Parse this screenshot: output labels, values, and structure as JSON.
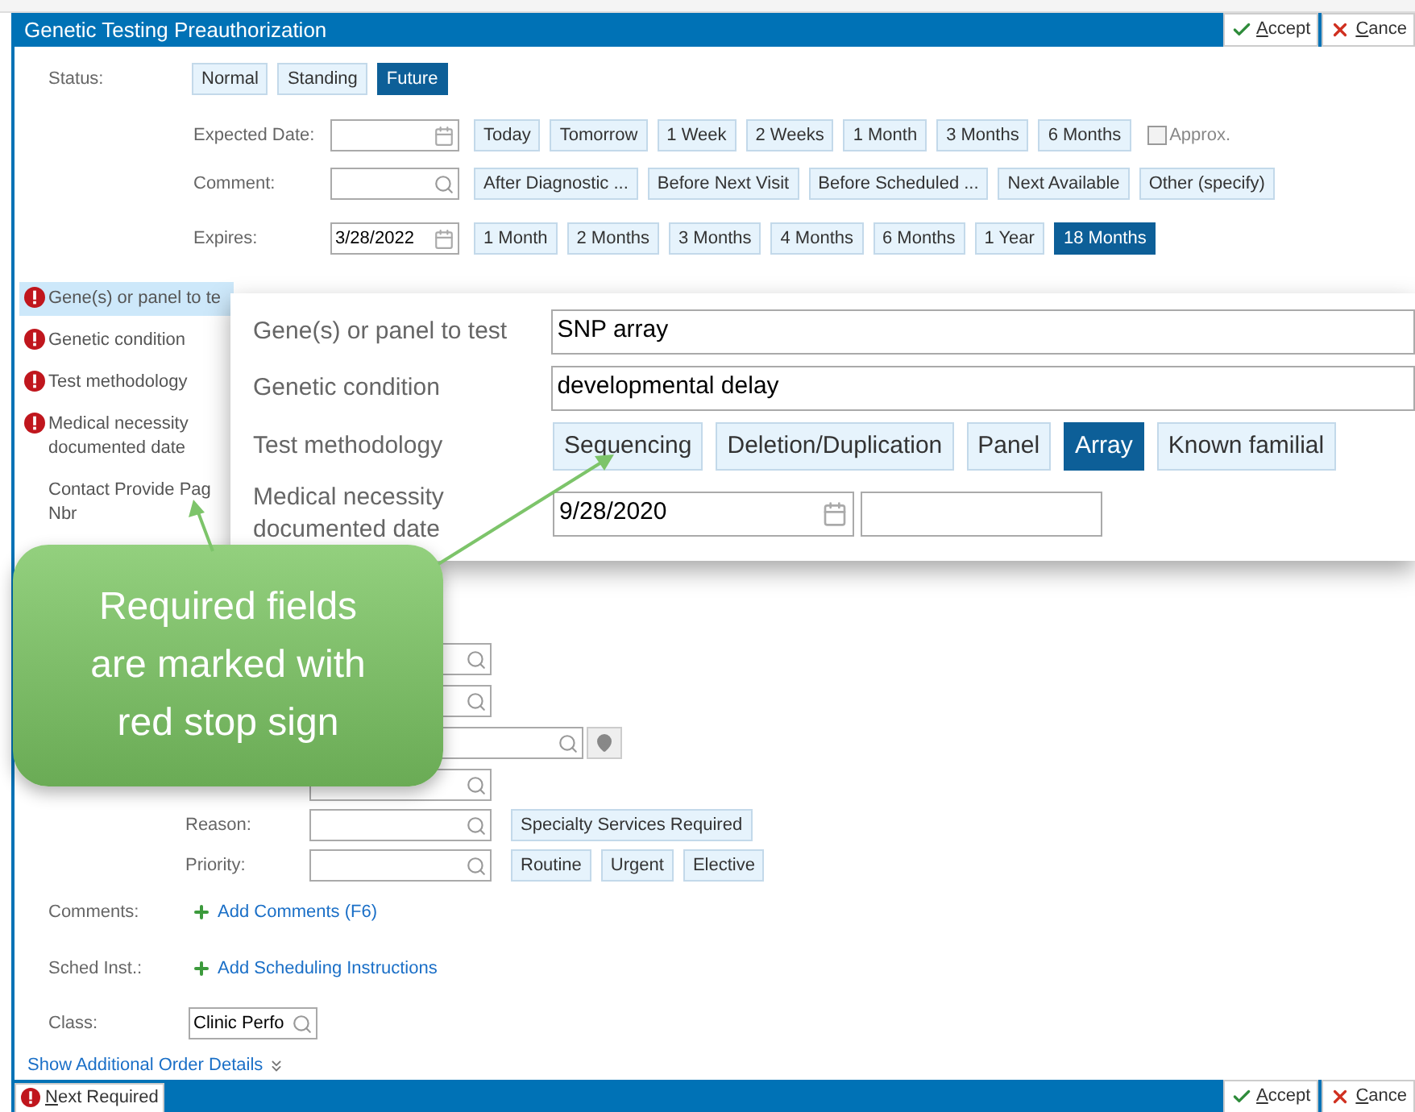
{
  "window": {
    "title": "Genetic Testing Preauthorization",
    "accept": "Accept",
    "cancel": "Cance"
  },
  "status": {
    "label": "Status:",
    "options": [
      {
        "label": "Normal",
        "selected": false
      },
      {
        "label": "Standing",
        "selected": false
      },
      {
        "label": "Future",
        "selected": true
      }
    ]
  },
  "expected_date": {
    "label": "Expected Date:",
    "quick": [
      {
        "label": "Today",
        "selected": false
      },
      {
        "label": "Tomorrow",
        "selected": false
      },
      {
        "label": "1 Week",
        "selected": false
      },
      {
        "label": "2 Weeks",
        "selected": false
      },
      {
        "label": "1 Month",
        "selected": false
      },
      {
        "label": "3 Months",
        "selected": false
      },
      {
        "label": "6 Months",
        "selected": false
      }
    ],
    "approx": {
      "label": "Approx.",
      "checked": false
    }
  },
  "comment": {
    "label": "Comment:",
    "quick": [
      {
        "label": "After Diagnostic ...",
        "selected": false
      },
      {
        "label": "Before Next Visit",
        "selected": false
      },
      {
        "label": "Before Scheduled ...",
        "selected": false
      },
      {
        "label": "Next Available",
        "selected": false
      },
      {
        "label": "Other (specify)",
        "selected": false
      }
    ]
  },
  "expires": {
    "label": "Expires:",
    "value": "3/28/2022",
    "quick": [
      {
        "label": "1 Month",
        "selected": false
      },
      {
        "label": "2 Months",
        "selected": false
      },
      {
        "label": "3 Months",
        "selected": false
      },
      {
        "label": "4 Months",
        "selected": false
      },
      {
        "label": "6 Months",
        "selected": false
      },
      {
        "label": "1 Year",
        "selected": false
      },
      {
        "label": "18 Months",
        "selected": true
      }
    ]
  },
  "question_list": [
    {
      "label": "Gene(s) or panel to te",
      "required": true,
      "selected": true
    },
    {
      "label": "Genetic condition",
      "required": true,
      "selected": false
    },
    {
      "label": "Test methodology",
      "required": true,
      "selected": false
    },
    {
      "label": "Medical necessity documented date",
      "required": true,
      "selected": false
    },
    {
      "label": "Contact Provide Pag",
      "continuation": "Nbr",
      "required": false,
      "selected": false
    }
  ],
  "zoom_panel": {
    "rows": [
      {
        "kind": "text",
        "label": "Gene(s) or panel to test",
        "value": "SNP array"
      },
      {
        "kind": "text",
        "label": "Genetic condition",
        "value": "developmental delay"
      },
      {
        "kind": "options",
        "label": "Test methodology",
        "options": [
          {
            "label": "Sequencing",
            "selected": false
          },
          {
            "label": "Deletion/Duplication",
            "selected": false
          },
          {
            "label": "Panel",
            "selected": false
          },
          {
            "label": "Array",
            "selected": true
          },
          {
            "label": "Known familial",
            "selected": false
          }
        ]
      },
      {
        "kind": "date",
        "label": "Medical necessity documented date",
        "value": "9/28/2020"
      }
    ]
  },
  "callout": {
    "text": "Required fields are marked with red stop sign"
  },
  "lookup_fields": [
    {
      "kind": "lookup"
    },
    {
      "kind": "lookup"
    },
    {
      "kind": "location"
    },
    {
      "kind": "lookup"
    }
  ],
  "reason": {
    "label": "Reason:",
    "quick": [
      {
        "label": "Specialty Services Required",
        "selected": false
      }
    ]
  },
  "priority": {
    "label": "Priority:",
    "quick": [
      {
        "label": "Routine",
        "selected": false
      },
      {
        "label": "Urgent",
        "selected": false
      },
      {
        "label": "Elective",
        "selected": false
      }
    ]
  },
  "comments": {
    "label": "Comments:",
    "link": "Add Comments (F6)"
  },
  "sched_inst": {
    "label": "Sched Inst.:",
    "link": "Add Scheduling Instructions"
  },
  "class": {
    "label": "Class:",
    "value": "Clinic Perfo"
  },
  "show_more": "Show Additional Order Details",
  "footer": {
    "next_required": "Next Required",
    "accept": "Accept",
    "cancel": "Cance"
  }
}
